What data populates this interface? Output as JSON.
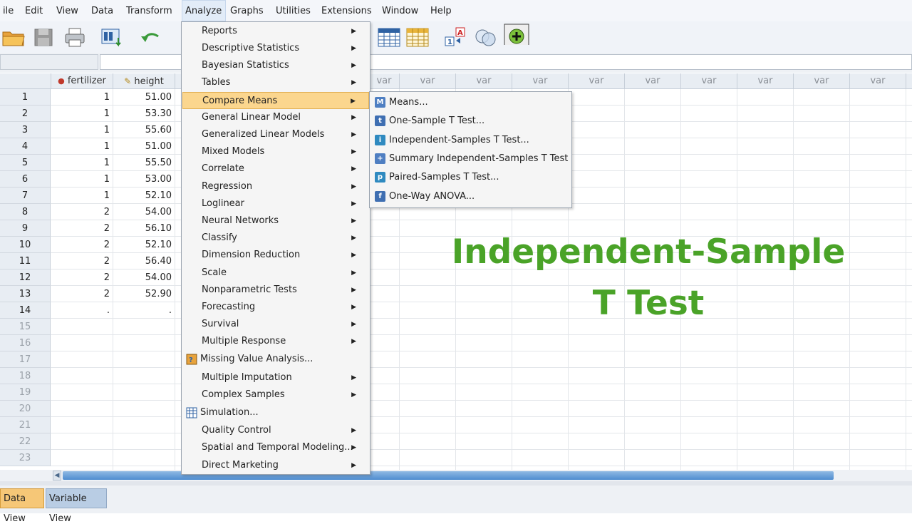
{
  "menubar": {
    "file": "ile",
    "edit": "Edit",
    "view": "View",
    "data": "Data",
    "transform": "Transform",
    "analyze": "Analyze",
    "graphs": "Graphs",
    "utilities": "Utilities",
    "extensions": "Extensions",
    "window": "Window",
    "help": "Help"
  },
  "grid": {
    "columns": [
      "fertilizer",
      "height"
    ],
    "var_label": "var",
    "row_numbers": [
      "1",
      "2",
      "3",
      "4",
      "5",
      "6",
      "7",
      "8",
      "9",
      "10",
      "11",
      "12",
      "13",
      "14",
      "15",
      "16",
      "17",
      "18",
      "19",
      "20",
      "21",
      "22",
      "23"
    ],
    "rows": [
      [
        "1",
        "51.00"
      ],
      [
        "1",
        "53.30"
      ],
      [
        "1",
        "55.60"
      ],
      [
        "1",
        "51.00"
      ],
      [
        "1",
        "55.50"
      ],
      [
        "1",
        "53.00"
      ],
      [
        "1",
        "52.10"
      ],
      [
        "2",
        "54.00"
      ],
      [
        "2",
        "56.10"
      ],
      [
        "2",
        "52.10"
      ],
      [
        "2",
        "56.40"
      ],
      [
        "2",
        "54.00"
      ],
      [
        "2",
        "52.90"
      ],
      [
        ".",
        "."
      ]
    ]
  },
  "analyze_menu": {
    "items": [
      "Reports",
      "Descriptive Statistics",
      "Bayesian Statistics",
      "Tables",
      "Compare Means",
      "General Linear Model",
      "Generalized Linear Models",
      "Mixed Models",
      "Correlate",
      "Regression",
      "Loglinear",
      "Neural Networks",
      "Classify",
      "Dimension Reduction",
      "Scale",
      "Nonparametric Tests",
      "Forecasting",
      "Survival",
      "Multiple Response",
      "Missing Value Analysis...",
      "Multiple Imputation",
      "Complex Samples",
      "Simulation...",
      "Quality Control",
      "Spatial and Temporal Modeling...",
      "Direct Marketing"
    ]
  },
  "compare_means_submenu": {
    "items": [
      "Means...",
      "One-Sample T Test...",
      "Independent-Samples T Test...",
      "Summary Independent-Samples T Test",
      "Paired-Samples T Test...",
      "One-Way ANOVA..."
    ]
  },
  "overlay": {
    "line1": "Independent-Sample",
    "line2": "T Test"
  },
  "tabs": {
    "data_view": "Data View",
    "variable_view": "Variable View"
  },
  "colors": {
    "accent_green": "#4aa328",
    "menu_highlight": "#fbd68e",
    "scroll_blue": "#4f8dd0"
  }
}
